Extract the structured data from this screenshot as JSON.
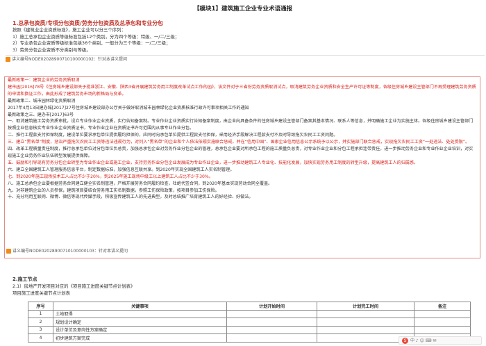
{
  "title": "【模块1】建筑施工企业专业术语通报",
  "section1": {
    "heading": "1.总承包资质/专项分包资质/劳务分包资质及总承包和专业分包",
    "lines": [
      "按照《建筑业企业资质标准》，施工企业可以分三个序列：",
      "1）施工总承包企业资质等级标准包括12个类别，分为四个等级：特级、一/二/三级；",
      "2）专业承包企业资质等级标准包括36个类别，一般分为三个等级：一/二/三级；",
      "3）劳务分包企业资质不分类别与等级。"
    ],
    "query": "讲义编号NODE02028900710100000102：针对本讲义提问"
  },
  "section2": {
    "lines": [
      {
        "t": "最新政策一：建筑企业的劳务资质取消",
        "red": true
      },
      {
        "t": "建市函[2016]78号《住房城乡建设部关于批准浙江、安徽、陕西3省开展建筑劳务用工制度改革试点工作的函》，该文件对于三省份劳务资质取消试点，取消建筑劳务企业资质和安全生产许可证等制度，各级住房城乡建设主管部门不再受理建筑劳务资质的申请和换证工作，由此形成了建筑劳务市场的新格局与变革。",
        "red": true
      },
      {
        "t": "最新政策二、城市园林绿化资质取消",
        "red": false
      },
      {
        "t": "2017年4月13日建办城[2017]27号住房城乡建设部办公厅关于做好取消城市园林绿化企业资质核准行政许可事项相关工作的通知",
        "red": false
      },
      {
        "t": "最新政策之三、建办市[2017]63号",
        "red": false
      },
      {
        "t": "一、取消建筑施工劳务资质审批，设立专业作业企业资质，实行告知备案制。专业作业企业资质实行告知备案制度，由企业向具备条件的住房城乡建设主管部门备案其基本情况、联系人等信息，并明确施工企业为实施主体。各级住房城乡建设主管部门按照企业信息核实专业作业企业资质证书，专业作业企业在资质证书许可范围内从事专业作业分包。",
        "red": false
      },
      {
        "t": "二、推行工程款支付担保制度，建设单位要求承包单位提供履约担保的，应同时向承包单位提供工程款支付担保，采用经济手段解决工程款支付不及时导致拖欠农民工工资问题。",
        "red": false
      },
      {
        "t": "三、建立“黑名单”制度，惩治严重拖欠农民工工资等违法违规行为，对列入“黑名单”的企业和个人依法依规实施联合惩戒，并在“信用中国”、国家企业信用信息公示系统予以公示，并实施部门联合惩戒，实现拖欠农民工工资“一处违法、处处受限”。",
        "red": true
      },
      {
        "t": "四、改革工程质量责任制度，推行总承包单位对分包单位负总责，加强总承包企业对劳务作业分包企业的管理，总承包企业要对所承包工程的施工质量负总责，对专业作业企业和分包工程承担连带责任，进一步推动劳务企业和专业作业企业培训，对实现施工企业劳务作业队伍转型发展提供保障。",
        "red": false
      },
      {
        "t": "五、鼓励和引导现有劳务分包企业转型为专业作业企业或施工企业，支持劳务作业分包企业发展成为专业作业企业，进一步推动建筑工人专业化、技能化发展，加快实现劳务用工制度的转型升级，提高建筑工人的归属感。",
        "red": true
      },
      {
        "t": "六、建立全国建筑工人管理服务信息平台，制定数据标准，加强信息互联共享。到2020年实现全国建筑工人实名制管理。",
        "red": false
      },
      {
        "t": "七、到2020年施工现场技术工人占比不少于20%，到2025年施工现场中级工以上建筑工人占比不少于30%。",
        "red": true
      },
      {
        "t": "八、施工总承包企业要根据劳务合同建立健全实名制管理，严格开展劳务合同履约检查，杜绝代签合同，到2020年基本实现劳动合同全覆盖。",
        "red": false
      },
      {
        "t": "九、对非建筑企业的人员参保，建筑项目要结合劳务用工实名制数据，参照工伤保险政策，按项目参加工伤保险。",
        "red": false
      },
      {
        "t": "十、充分利用互联网、微博、微信等现代传媒手段，积极宣传建筑工人的先进典型，及时总结推广培育建筑工人的好经验、好做法。",
        "red": false
      }
    ],
    "query": "讲义编号NODE02028900710100000103：针对本讲义提问"
  },
  "section3": {
    "heading": "2.施工节点",
    "sub": "2.1）房地产开发项目对应的《项目施工进度关键节点计划表》",
    "caption": "项目施工进度关键节点计划表",
    "headers": [
      "序号",
      "关键事项",
      "计划开始时间",
      "计划完工时间",
      "备注"
    ],
    "rows": [
      [
        "1",
        "土地取得",
        "",
        "",
        ""
      ],
      [
        "2",
        "规划设计确定",
        "",
        "",
        ""
      ],
      [
        "3",
        "设计单位及意向性方案确定",
        "",
        "",
        ""
      ],
      [
        "4",
        "初步建筑方案完成",
        "",
        "",
        ""
      ]
    ]
  },
  "corner": {
    "label": "中 ♪ ☺ ⌨ ✉"
  }
}
